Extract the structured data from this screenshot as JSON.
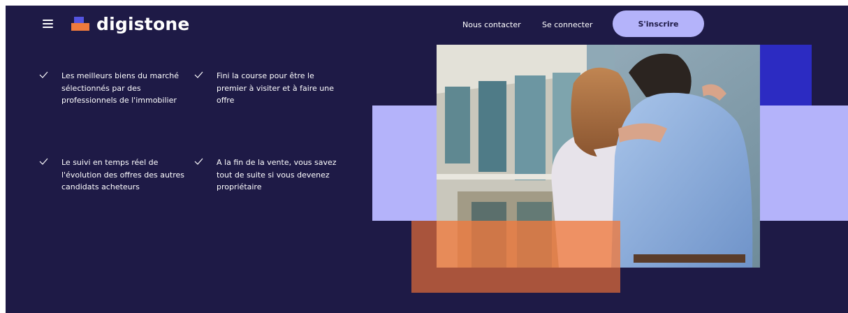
{
  "brand": {
    "name": "digistone"
  },
  "nav": {
    "contact": "Nous contacter",
    "login": "Se connecter",
    "signup": "S'inscrire"
  },
  "features": [
    {
      "text": "Les meilleurs biens du marché sélectionnés par des professionnels de l'immobilier"
    },
    {
      "text": "Fini la course pour être le premier à visiter et à faire une offre"
    },
    {
      "text": "Le suivi en temps réel de l'évolution des offres des autres candidats acheteurs"
    },
    {
      "text": "A la fin de la vente, vous savez tout de suite si vous devenez propriétaire"
    }
  ],
  "icons": {
    "menu": "menu-icon",
    "check": "check-icon"
  },
  "colors": {
    "background": "#1e1a46",
    "accent_violet": "#b4b3fa",
    "accent_blue": "#2c2bc2",
    "accent_orange": "#f07a3d",
    "accent_rust": "#a9543c"
  }
}
